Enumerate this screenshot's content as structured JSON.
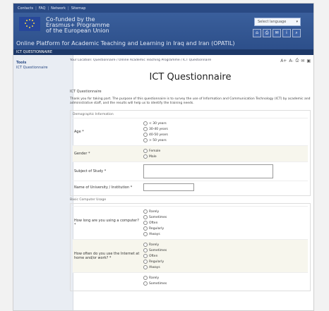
{
  "header": {
    "top_links": [
      "Contacts",
      "FAQ",
      "Network",
      "Sitemap"
    ],
    "flag": {
      "background": "#27479a",
      "stars": "#f1d34a"
    },
    "banner_lines": [
      "Co-funded by the",
      "Erasmus+ Programme",
      "of the European Union"
    ],
    "platform_title": "Online Platform for Academic Teaching and Learning in Iraq and Iran (OPATIL)",
    "language_select": "Select language",
    "tool_icons": [
      "home-icon",
      "print-icon",
      "mail-icon",
      "info-icon",
      "search-icon"
    ],
    "nav_label": "ICT QUESTIONNAIRE"
  },
  "sidebar": {
    "title": "Tools",
    "items": [
      {
        "label": "ICT Questionnaire"
      }
    ]
  },
  "content": {
    "breadcrumb": "Your Location: Questionnaire / Online Academic Teaching Programme / ICT Questionnaire",
    "font_tools": [
      "A+",
      "A-"
    ],
    "page_icons": [
      "print-icon",
      "email-icon",
      "pdf-icon"
    ],
    "page_title": "ICT Questionnaire",
    "subtitle": "ICT Questionnaire",
    "intro": "Thank you for taking part. The purpose of this questionnaire is to survey the use of Information and Communication Technology (ICT) by academic and administrative staff, and the results will help us to identify the training needs.",
    "section1": {
      "legend": "Demographic Information",
      "age": {
        "label": "Age *",
        "options": [
          "< 30 years",
          "30-40 years",
          "40-50 years",
          "> 50 years"
        ]
      },
      "gender": {
        "label": "Gender *",
        "options": [
          "Female",
          "Male"
        ]
      },
      "subject": {
        "label": "Subject of Study *"
      },
      "university": {
        "label": "Name of University / Institution *"
      }
    },
    "section2": {
      "legend": "Basic Computer Usage",
      "q1": {
        "label": "How long are you using a computer? *",
        "options": [
          "Rarely",
          "Sometimes",
          "Often",
          "Regularly",
          "Always"
        ]
      },
      "q2": {
        "label": "How often do you use the Internet at home and/or work? *",
        "options": [
          "Rarely",
          "Sometimes",
          "Often",
          "Regularly",
          "Always"
        ]
      },
      "q3": {
        "options": [
          "Rarely",
          "Sometimes"
        ]
      }
    }
  }
}
